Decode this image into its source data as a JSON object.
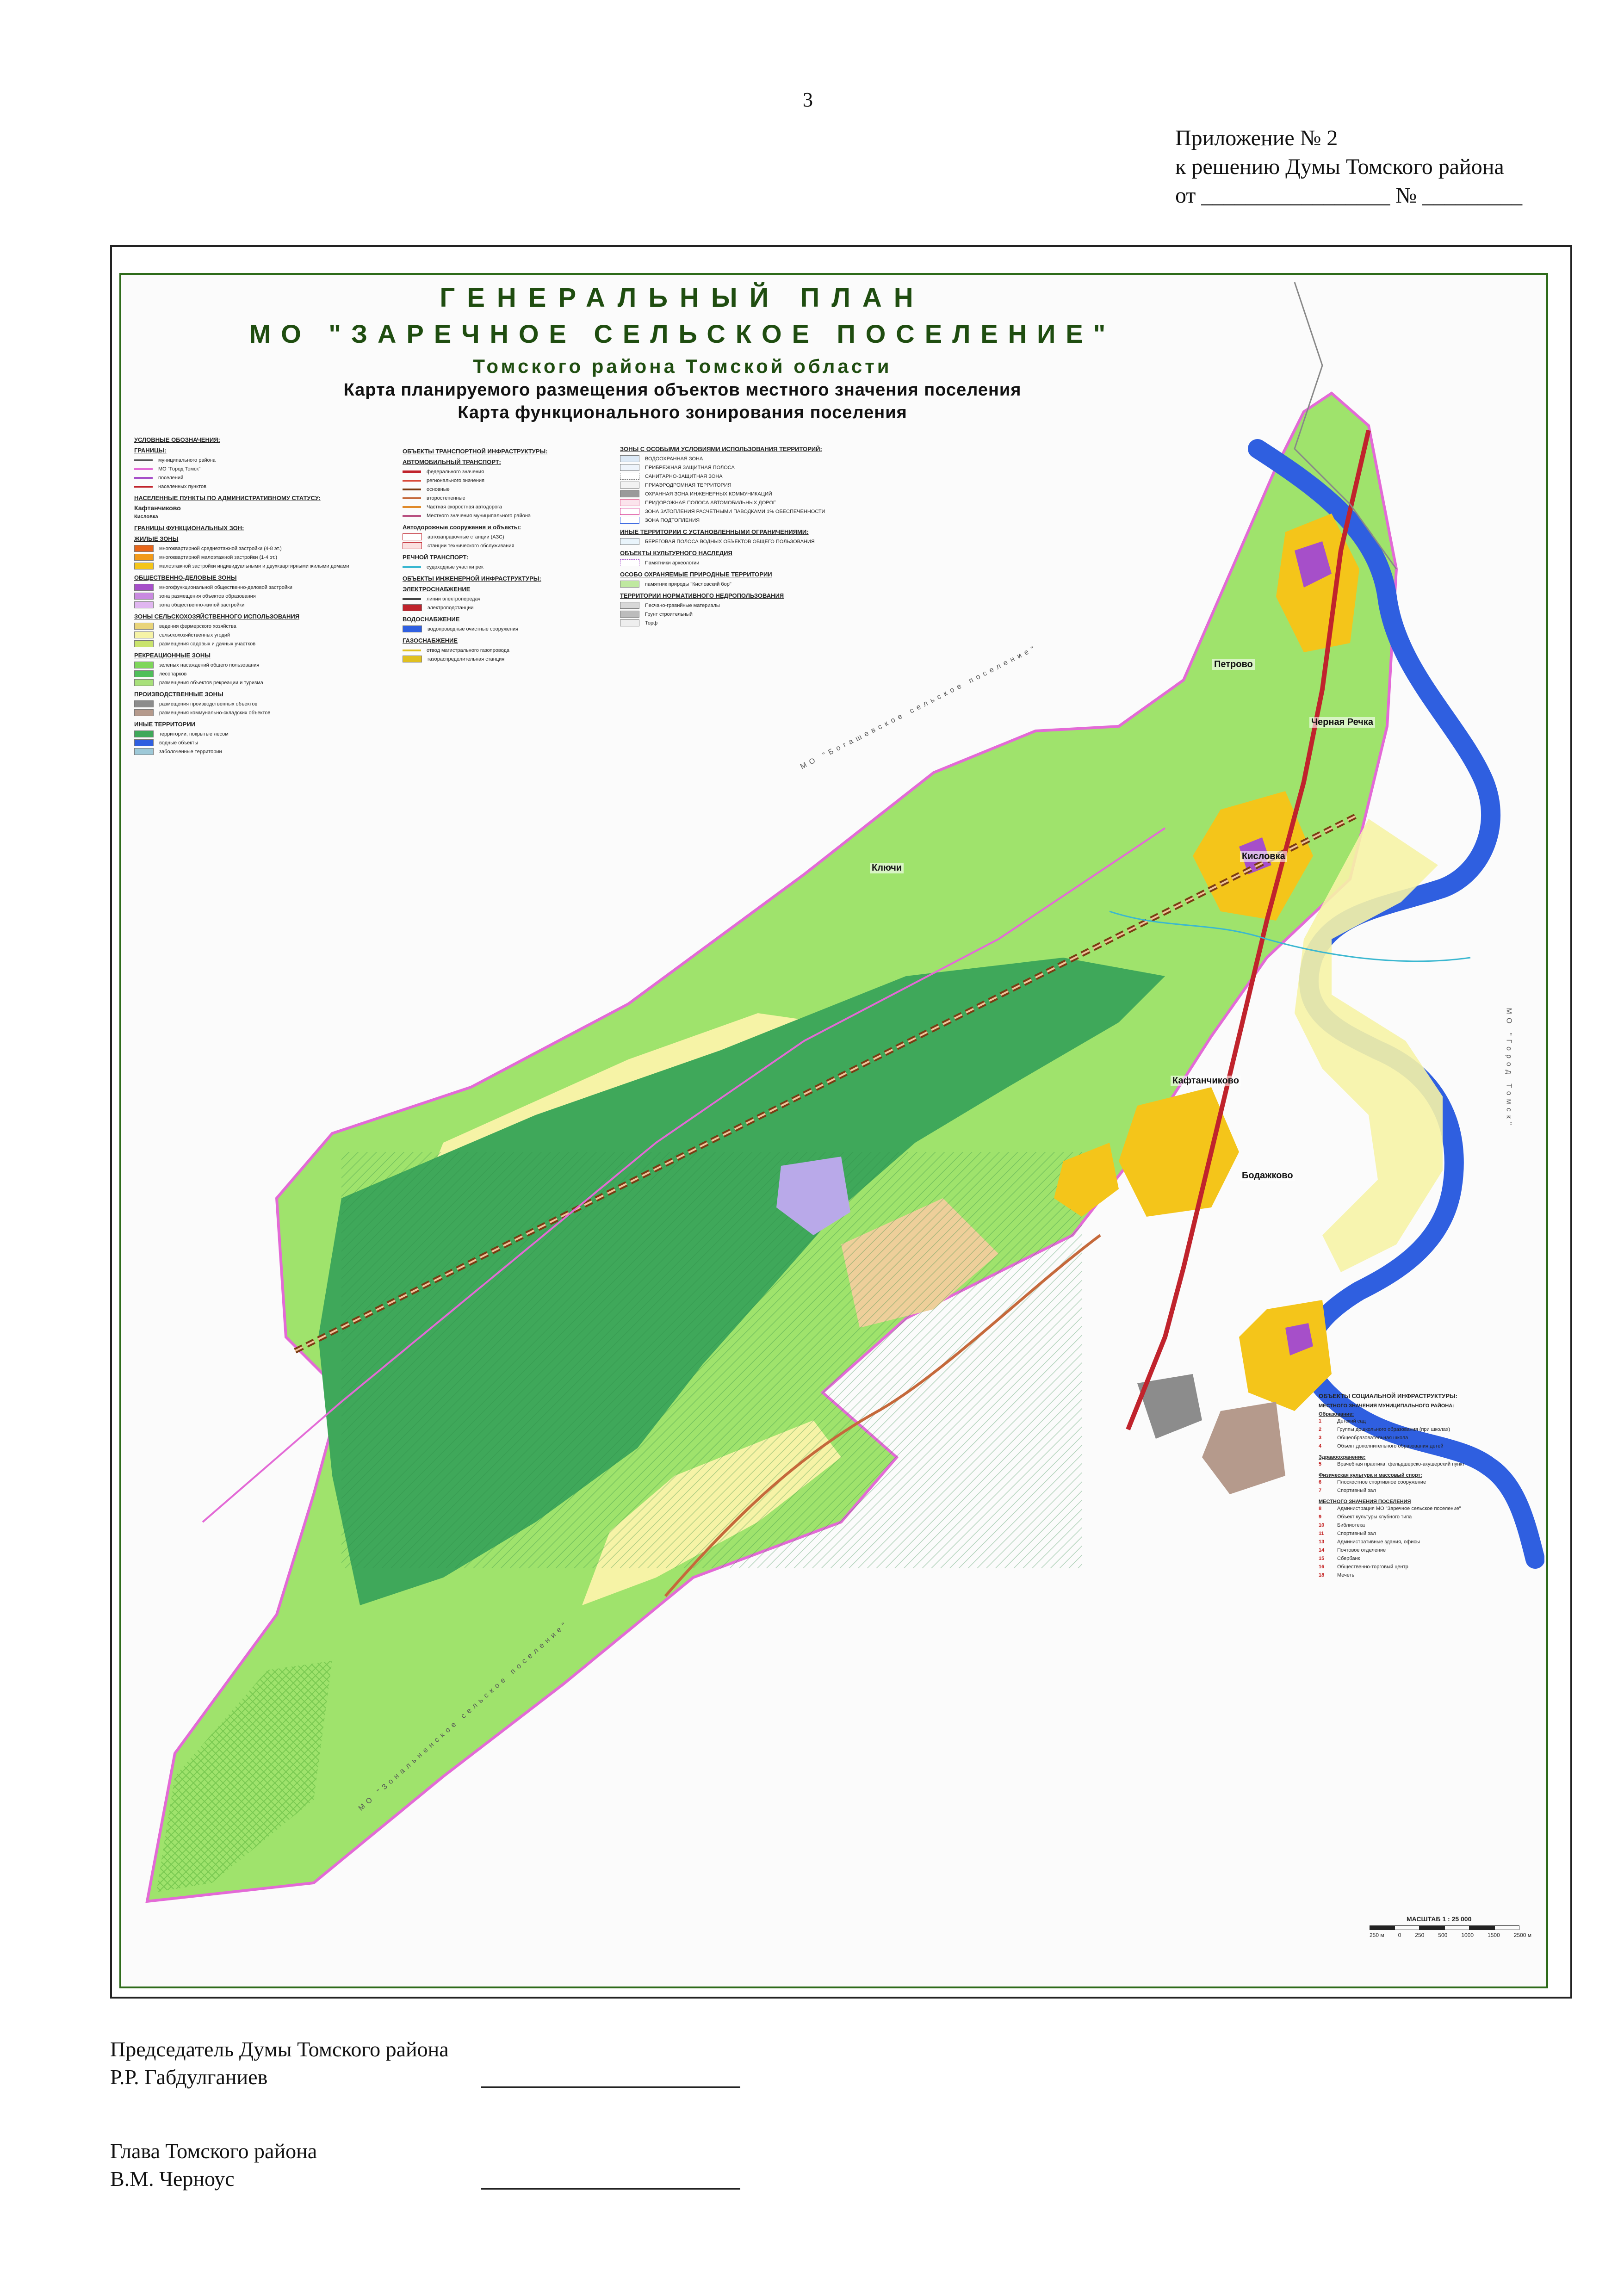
{
  "page_number": "3",
  "appendix": {
    "line1": "Приложение № 2",
    "line2": "к решению Думы Томского района",
    "line3": "от _________________ № _________"
  },
  "map": {
    "title": "ГЕНЕРАЛЬНЫЙ ПЛАН",
    "subtitle": "МО \"ЗАРЕЧНОЕ СЕЛЬСКОЕ ПОСЕЛЕНИЕ\"",
    "region": "Томского района Томской области",
    "map_name_1": "Карта планируемого размещения объектов местного значения поселения",
    "map_name_2": "Карта функционального зонирования поселения",
    "colors": {
      "forest": "#3fa85a",
      "agri": "#9fe36c",
      "meadow": "#f6f3a6",
      "water": "#2f5fe0",
      "residential": "#f4c51a",
      "public": "#a64fc9",
      "industrial": "#8c8c8c",
      "boundary": "#e36ad6",
      "road": "#c0232c",
      "special": "#b9a9e9"
    },
    "places": {
      "p1": "Кафтанчиково",
      "p2": "Петрово",
      "p3": "Черная Речка",
      "p4": "Кисловка",
      "p5": "Ключи",
      "p6": "Бодажково"
    },
    "border_labels": {
      "b1": "МО \"Богашевское сельское поселение\"",
      "b2": "МО \"Зональненское сельское поселение\"",
      "b3": "МО \"Город Томск\""
    }
  },
  "legend_left": {
    "head1": "УСЛОВНЫЕ ОБОЗНАЧЕНИЯ:",
    "head2": "ГРАНИЦЫ:",
    "r1": "муниципального района",
    "r2": "МО \"Город Томск\"",
    "r3": "поселений",
    "r4": "населенных пунктов",
    "head3": "НАСЕЛЕННЫЕ ПУНКТЫ ПО АДМИНИСТРАТИВНОМУ СТАТУСУ:",
    "r5": "Кафтанчиково",
    "r6": "Кисловка",
    "head4": "ГРАНИЦЫ ФУНКЦИОНАЛЬНЫХ ЗОН:",
    "head5": "ЖИЛЫЕ ЗОНЫ",
    "r7": "многоквартирной среднеэтажной застройки (4-8 эт.)",
    "r8": "многоквартирной малоэтажной застройки (1-4 эт.)",
    "r9": "малоэтажной застройки индивидуальными и двухквартирными жилыми домами",
    "head6": "ОБЩЕСТВЕННО-ДЕЛОВЫЕ ЗОНЫ",
    "r10": "многофункциональной общественно-деловой застройки",
    "r11": "зона размещения объектов образования",
    "r12": "зона общественно-жилой застройки",
    "head7": "ЗОНЫ СЕЛЬСКОХОЗЯЙСТВЕННОГО ИСПОЛЬЗОВАНИЯ",
    "r13": "ведения фермерского хозяйства",
    "r14": "сельскохозяйственных угодий",
    "r15": "размещения садовых и дачных участков",
    "head8": "РЕКРЕАЦИОННЫЕ ЗОНЫ",
    "r16": "зеленых насаждений общего пользования",
    "r17": "лесопарков",
    "r18": "размещения объектов рекреации и туризма",
    "head9": "ПРОИЗВОДСТВЕННЫЕ ЗОНЫ",
    "r19": "размещения производственных объектов",
    "r20": "размещения коммунально-складских объектов",
    "head10": "ИНЫЕ ТЕРРИТОРИИ",
    "r21": "территории, покрытые лесом",
    "r22": "водные объекты",
    "r23": "заболоченные территории"
  },
  "legend_mid": {
    "head1": "ОБЪЕКТЫ ТРАНСПОРТНОЙ ИНФРАСТРУКТУРЫ:",
    "head2": "АВТОМОБИЛЬНЫЙ ТРАНСПОРТ:",
    "r1": "федерального значения",
    "r2": "регионального значения",
    "r3": "основные",
    "r4": "второстепенные",
    "r5": "Частная скоростная автодорога",
    "r6": "Местного значения муниципального района",
    "head3": "Автодорожные сооружения и объекты:",
    "r7": "автозаправочные станции (АЗС)",
    "r8": "станции технического обслуживания",
    "head4": "РЕЧНОЙ ТРАНСПОРТ:",
    "r9": "судоходные участки рек",
    "head5": "ОБЪЕКТЫ ИНЖЕНЕРНОЙ ИНФРАСТРУКТУРЫ:",
    "head6": "ЭЛЕКТРОСНАБЖЕНИЕ",
    "r10": "линии электропередач",
    "r11": "электроподстанции",
    "head7": "ВОДОСНАБЖЕНИЕ",
    "r12": "водопроводные очистные сооружения",
    "head8": "ГАЗОСНАБЖЕНИЕ",
    "r13": "отвод магистрального газопровода",
    "r14": "газораспределительная станция"
  },
  "legend_right": {
    "head1": "ЗОНЫ С ОСОБЫМИ УСЛОВИЯМИ ИСПОЛЬЗОВАНИЯ ТЕРРИТОРИЙ:",
    "r1": "ВОДООХРАННАЯ ЗОНА",
    "r2": "ПРИБРЕЖНАЯ ЗАЩИТНАЯ ПОЛОСА",
    "r3": "САНИТАРНО-ЗАЩИТНАЯ ЗОНА",
    "r4": "ПРИАЭРОДРОМНАЯ ТЕРРИТОРИЯ",
    "r5": "ОХРАННАЯ ЗОНА ИНЖЕНЕРНЫХ КОММУНИКАЦИЙ",
    "r6": "ПРИДОРОЖНАЯ ПОЛОСА АВТОМОБИЛЬНЫХ ДОРОГ",
    "r7": "ЗОНА ЗАТОПЛЕНИЯ РАСЧЕТНЫМИ ПАВОДКАМИ 1% ОБЕСПЕЧЕННОСТИ",
    "r8": "ЗОНА ПОДТОПЛЕНИЯ",
    "head2": "ИНЫЕ ТЕРРИТОРИИ С УСТАНОВЛЕННЫМИ ОГРАНИЧЕНИЯМИ:",
    "r9": "БЕРЕГОВАЯ ПОЛОСА ВОДНЫХ ОБЪЕКТОВ ОБЩЕГО ПОЛЬЗОВАНИЯ",
    "head3": "ОБЪЕКТЫ КУЛЬТУРНОГО НАСЛЕДИЯ",
    "r10": "Памятники археологии",
    "head4": "ОСОБО ОХРАНЯЕМЫЕ ПРИРОДНЫЕ ТЕРРИТОРИИ",
    "r11": "памятник природы \"Кисловский бор\"",
    "head5": "ТЕРРИТОРИИ НОРМАТИВНОГО НЕДРОПОЛЬЗОВАНИЯ",
    "r12": "Песчано-гравийные материалы",
    "r13": "Грунт строительный",
    "r14": "Торф"
  },
  "social": {
    "head": "ОБЪЕКТЫ СОЦИАЛЬНОЙ ИНФРАСТРУКТУРЫ:",
    "sub1": "МЕСТНОГО ЗНАЧЕНИЯ МУНИЦИПАЛЬНОГО РАЙОНА:",
    "sub2": "Образование:",
    "i1n": "1",
    "i1": "Детский сад",
    "i2n": "2",
    "i2": "Группы дошкольного образования (при школах)",
    "i3n": "3",
    "i3": "Общеобразовательная школа",
    "i4n": "4",
    "i4": "Объект дополнительного образования детей",
    "sub3": "Здравоохранение:",
    "i5n": "5",
    "i5": "Врачебная практика, фельдшерско-акушерский пункт",
    "sub4": "Физическая культура и массовый спорт:",
    "i6n": "6",
    "i6": "Плоскостное спортивное сооружение",
    "i7n": "7",
    "i7": "Спортивный зал",
    "sub5": "МЕСТНОГО ЗНАЧЕНИЯ ПОСЕЛЕНИЯ",
    "i8n": "8",
    "i8": "Администрация МО \"Заречное сельское поселение\"",
    "i9n": "9",
    "i9": "Объект культуры клубного типа",
    "i10n": "10",
    "i10": "Библиотека",
    "i11n": "11",
    "i11": "Спортивный зал",
    "i13n": "13",
    "i13": "Административные здания, офисы",
    "i14n": "14",
    "i14": "Почтовое отделение",
    "i15n": "15",
    "i15": "Сбербанк",
    "i16n": "16",
    "i16": "Общественно-торговый центр",
    "i18n": "18",
    "i18": "Мечеть"
  },
  "scale": {
    "label": "МАСШТАБ 1 : 25 000",
    "t1": "250 м",
    "t2": "0",
    "t3": "250",
    "t4": "500",
    "t5": "1000",
    "t6": "1500",
    "t7": "2500 м"
  },
  "signatures": {
    "s1_title": "Председатель Думы Томского района",
    "s1_name": "Р.Р. Габдулганиев",
    "s2_title": "Глава Томского района",
    "s2_name": "В.М. Черноус"
  }
}
